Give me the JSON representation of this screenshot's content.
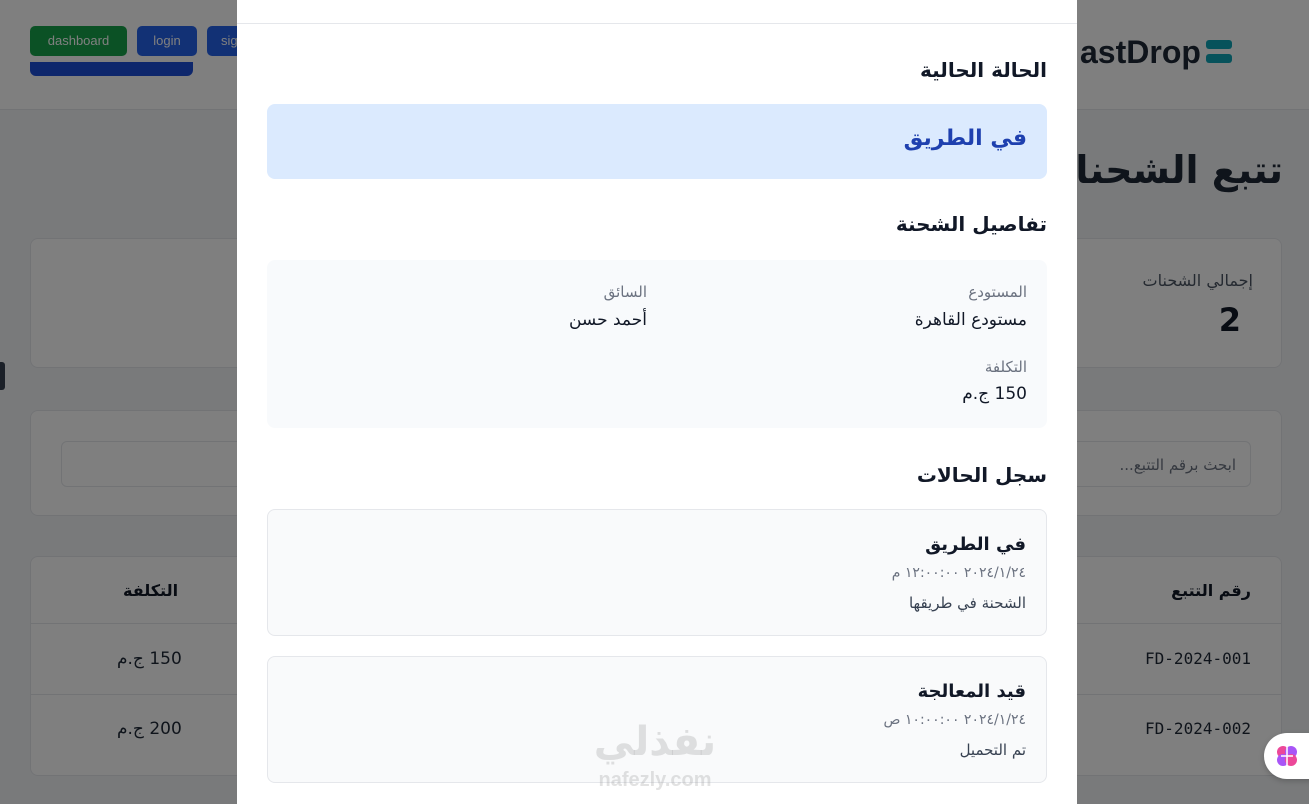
{
  "dev_nav": {
    "dashboard": "dashboard",
    "login": "login",
    "signup_partial": "sig"
  },
  "brand": {
    "name": "FastDrop",
    "visible_name": "astDrop"
  },
  "page": {
    "title": "تتبع الشحنات"
  },
  "stats": {
    "total_label": "إجمالي الشحنات",
    "total_value": "2"
  },
  "search": {
    "placeholder": "ابحث برقم التتبع..."
  },
  "table": {
    "headers": {
      "tracking": "رقم التتبع",
      "cost": "التكلفة"
    },
    "rows": [
      {
        "tracking": "FD-2024-001",
        "cost": "150 ج.م"
      },
      {
        "tracking": "FD-2024-002",
        "cost": "200 ج.م"
      }
    ]
  },
  "modal": {
    "current_status_heading": "الحالة الحالية",
    "current_status": "في الطريق",
    "details_heading": "تفاصيل الشحنة",
    "details": {
      "warehouse_label": "المستودع",
      "warehouse_value": "مستودع القاهرة",
      "driver_label": "السائق",
      "driver_value": "أحمد حسن",
      "cost_label": "التكلفة",
      "cost_value": "150 ج.م"
    },
    "history_heading": "سجل الحالات",
    "history": [
      {
        "status": "في الطريق",
        "datetime": "٢٠٢٤/١/٢٤ ١٢:٠٠:٠٠ م",
        "note": "الشحنة في طريقها"
      },
      {
        "status": "قيد المعالجة",
        "datetime": "٢٠٢٤/١/٢٤ ١٠:٠٠:٠٠ ص",
        "note": "تم التحميل"
      }
    ]
  },
  "watermark": {
    "arabic": "نفذلي",
    "latin": "nafezly.com"
  },
  "colors": {
    "status_bg": "#dbeafe",
    "status_text": "#1e40af",
    "dashboard_btn": "#16a34a",
    "nav_btn": "#2563eb",
    "brand_accent": "#0ea5b7"
  },
  "icons": {
    "assistant": "brain-icon",
    "logo": "logo-icon"
  }
}
